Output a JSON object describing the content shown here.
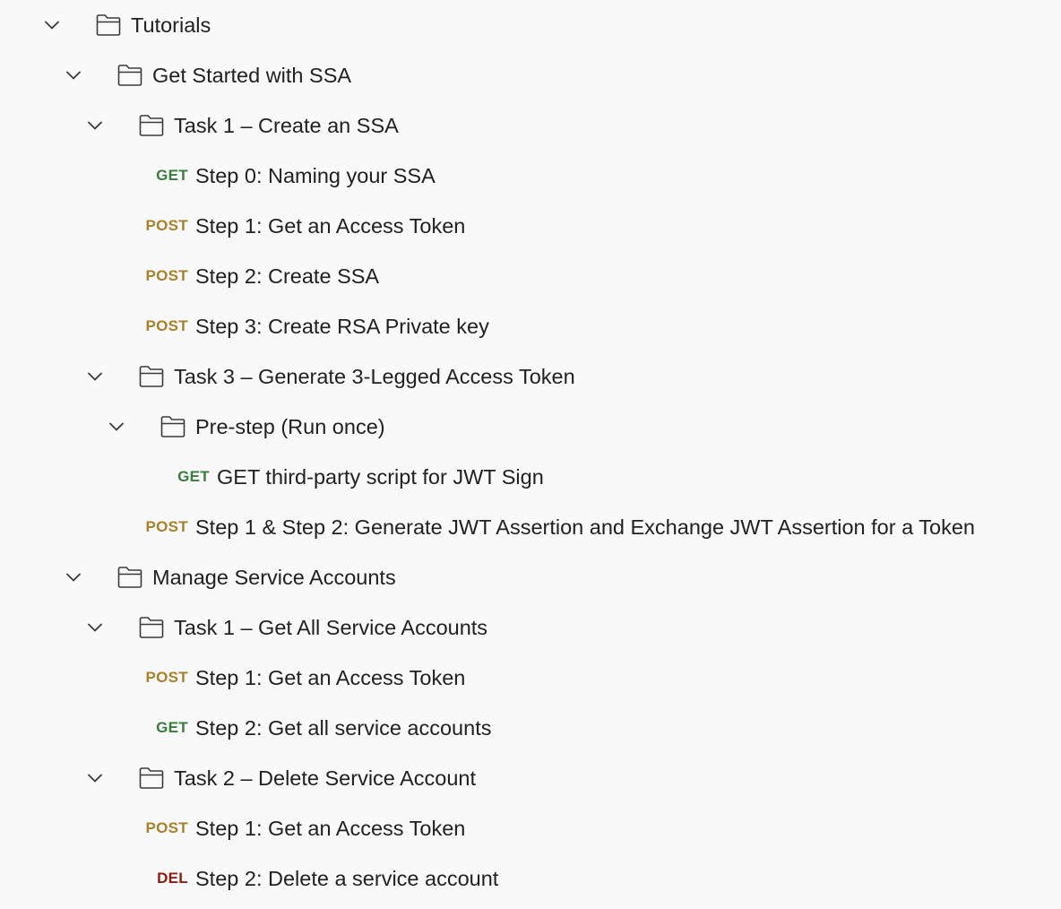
{
  "colors": {
    "background": "#f9f9f9",
    "text": "#212121",
    "get": "#3b7d3f",
    "post": "#a9802a",
    "del": "#8e1a10"
  },
  "icons": {
    "toggle": "chevron-down-icon",
    "folder": "folder-icon"
  },
  "tree": [
    {
      "type": "folder",
      "depth": 0,
      "expanded": true,
      "label": "Tutorials"
    },
    {
      "type": "folder",
      "depth": 1,
      "expanded": true,
      "label": "Get Started with SSA"
    },
    {
      "type": "folder",
      "depth": 2,
      "expanded": true,
      "label": "Task 1 – Create an SSA"
    },
    {
      "type": "request",
      "depth": 3,
      "method": "GET",
      "label": "Step 0: Naming your SSA"
    },
    {
      "type": "request",
      "depth": 3,
      "method": "POST",
      "label": "Step 1: Get an Access Token"
    },
    {
      "type": "request",
      "depth": 3,
      "method": "POST",
      "label": "Step 2: Create SSA"
    },
    {
      "type": "request",
      "depth": 3,
      "method": "POST",
      "label": "Step 3: Create RSA Private key"
    },
    {
      "type": "folder",
      "depth": 2,
      "expanded": true,
      "label": "Task 3 – Generate 3-Legged Access Token"
    },
    {
      "type": "folder",
      "depth": 3,
      "expanded": true,
      "label": "Pre-step (Run once)"
    },
    {
      "type": "request",
      "depth": 4,
      "method": "GET",
      "label": "GET third-party script for JWT Sign"
    },
    {
      "type": "request",
      "depth": 3,
      "method": "POST",
      "label": "Step 1 & Step 2: Generate JWT Assertion and Exchange JWT Assertion for a Token"
    },
    {
      "type": "folder",
      "depth": 1,
      "expanded": true,
      "label": "Manage Service Accounts"
    },
    {
      "type": "folder",
      "depth": 2,
      "expanded": true,
      "label": "Task 1 – Get All Service Accounts"
    },
    {
      "type": "request",
      "depth": 3,
      "method": "POST",
      "label": "Step 1: Get an Access Token"
    },
    {
      "type": "request",
      "depth": 3,
      "method": "GET",
      "label": "Step 2: Get all service accounts"
    },
    {
      "type": "folder",
      "depth": 2,
      "expanded": true,
      "label": "Task 2 – Delete Service Account"
    },
    {
      "type": "request",
      "depth": 3,
      "method": "POST",
      "label": "Step 1: Get an Access Token"
    },
    {
      "type": "request",
      "depth": 3,
      "method": "DEL",
      "label": "Step 2: Delete a service account"
    }
  ]
}
